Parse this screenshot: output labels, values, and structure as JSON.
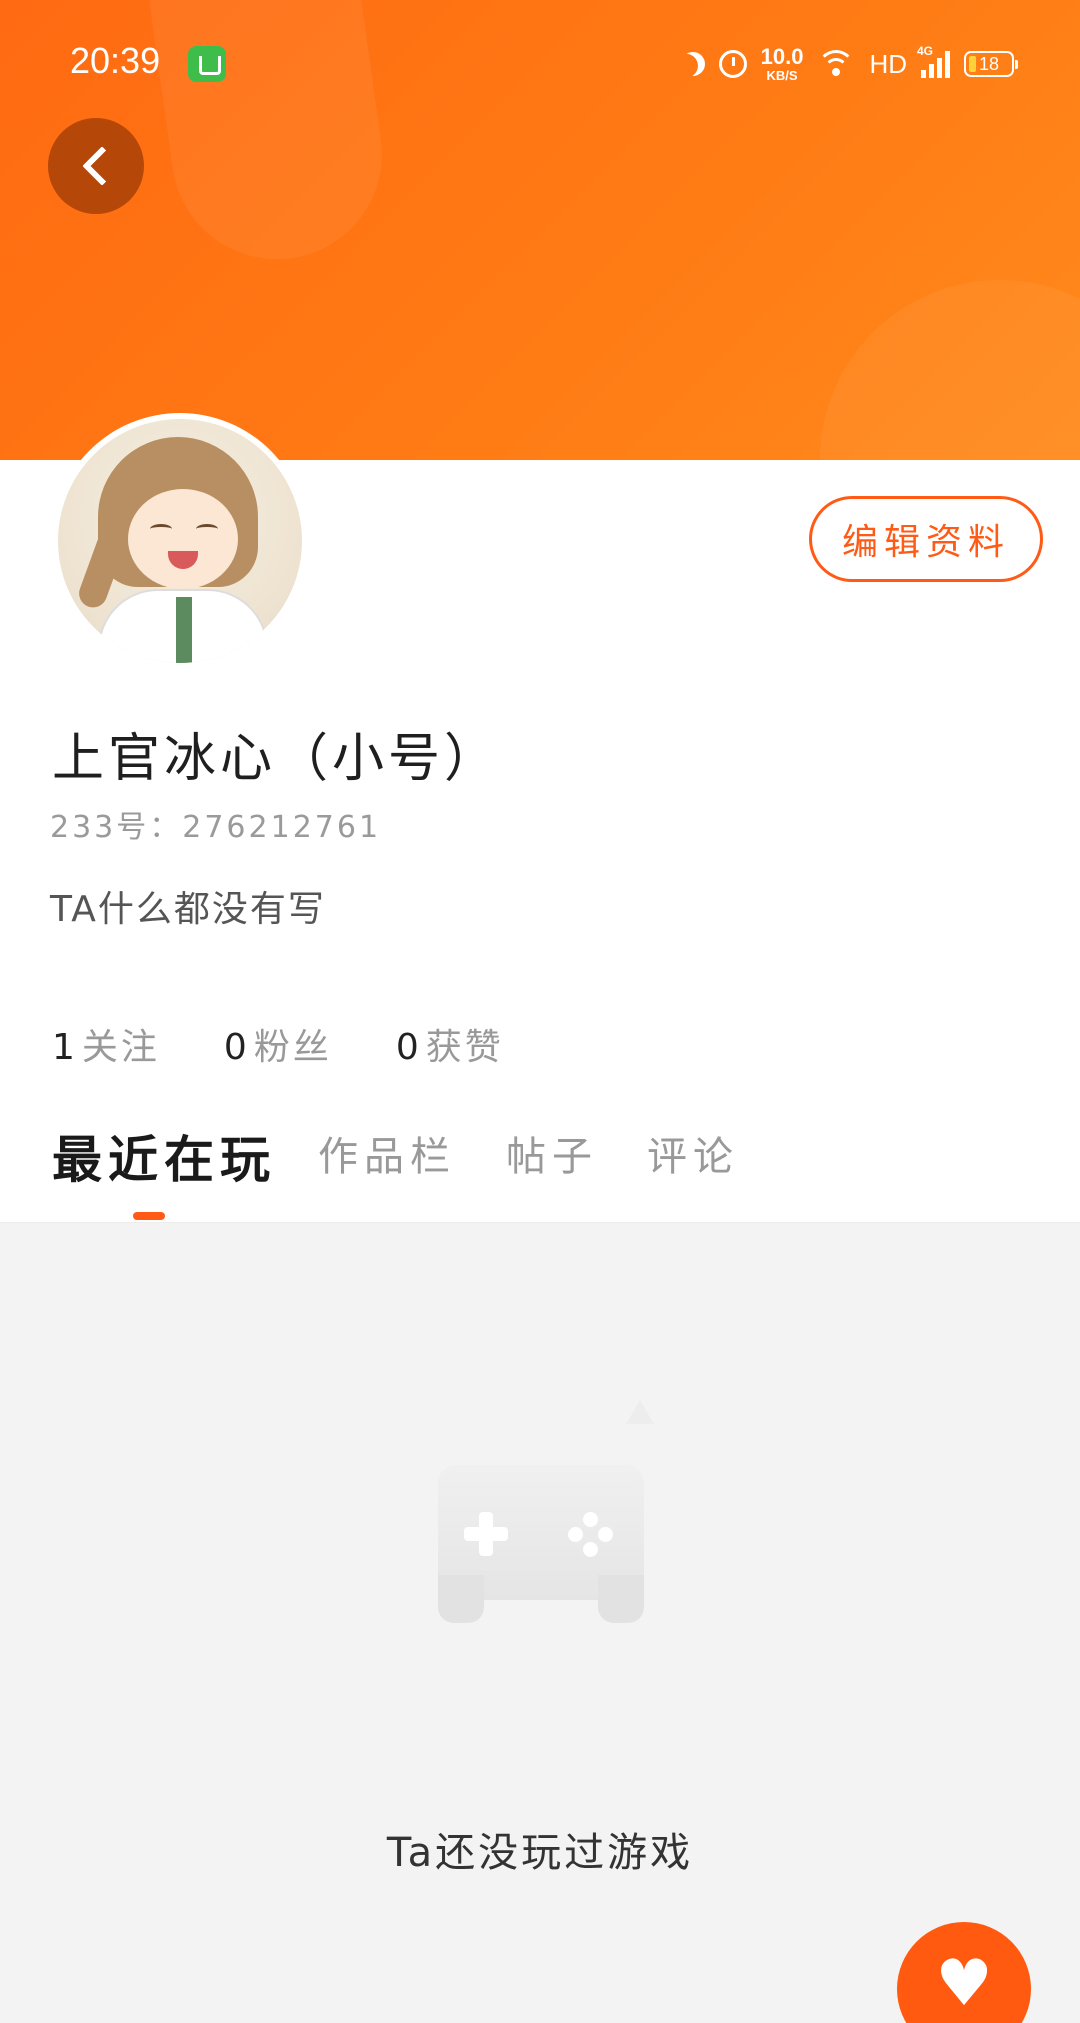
{
  "status_bar": {
    "time": "20:39",
    "net_speed_value": "10.0",
    "net_speed_unit": "KB/S",
    "hd_label": "HD",
    "network_label": "4G",
    "battery_level": "18",
    "icons": [
      "app-badge-icon",
      "moon-icon",
      "alarm-icon",
      "wifi-icon",
      "signal-icon",
      "battery-icon"
    ]
  },
  "header": {
    "back_icon": "chevron-left-icon",
    "accent_color": "#ff6a12"
  },
  "profile": {
    "nickname": "上官冰心（小号）",
    "user_id": "233号：276212761",
    "bio": "TA什么都没有写",
    "edit_button": "编辑资料"
  },
  "stats": [
    {
      "count": "1",
      "label": "关注"
    },
    {
      "count": "0",
      "label": "粉丝"
    },
    {
      "count": "0",
      "label": "获赞"
    }
  ],
  "tabs": [
    {
      "label": "最近在玩",
      "active": true
    },
    {
      "label": "作品栏",
      "active": false
    },
    {
      "label": "帖子",
      "active": false
    },
    {
      "label": "评论",
      "active": false
    }
  ],
  "empty_state": {
    "icon": "gamepad-icon",
    "text": "Ta还没玩过游戏"
  },
  "fab": {
    "icon": "heart-icon",
    "color": "#ff5a0f"
  }
}
